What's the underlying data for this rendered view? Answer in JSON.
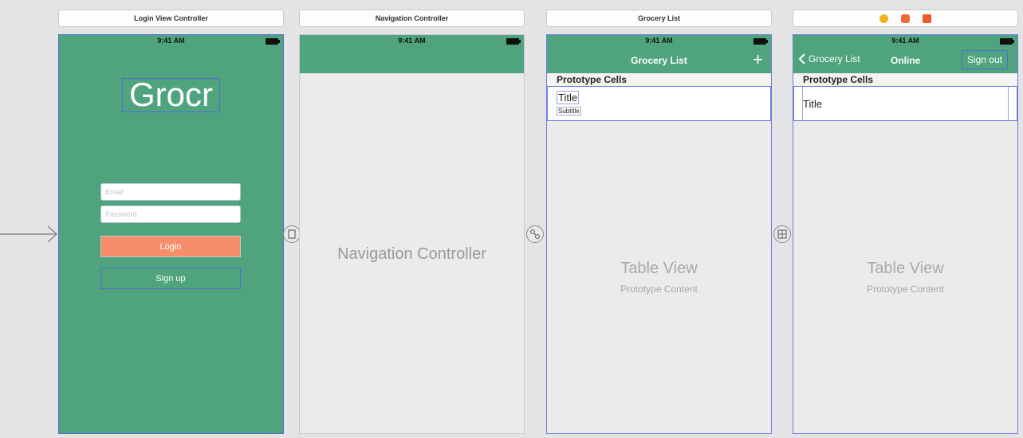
{
  "scenes": {
    "login": {
      "title": "Login View Controller",
      "time": "9:41 AM",
      "logo": "Grocr",
      "email_placeholder": "Email",
      "password_placeholder": "Password",
      "login_label": "Login",
      "signup_label": "Sign up"
    },
    "nav": {
      "title": "Navigation Controller",
      "time": "9:41 AM",
      "center_label": "Navigation Controller"
    },
    "grocery": {
      "title": "Grocery List",
      "time": "9:41 AM",
      "nav_title": "Grocery List",
      "add_symbol": "+",
      "section": "Prototype Cells",
      "cell_title": "Title",
      "cell_subtitle": "Subtitle",
      "table_label": "Table View",
      "table_sub": "Prototype Content"
    },
    "online": {
      "time": "9:41 AM",
      "back_label": "Grocery List",
      "nav_title": "Online",
      "signout_label": "Sign out",
      "section": "Prototype Cells",
      "cell_title": "Title",
      "table_label": "Table View",
      "table_sub": "Prototype Content"
    }
  },
  "colors": {
    "accent_green": "#4fa47e",
    "login_button": "#f68e6c",
    "canvas": "#e4e4e7"
  }
}
